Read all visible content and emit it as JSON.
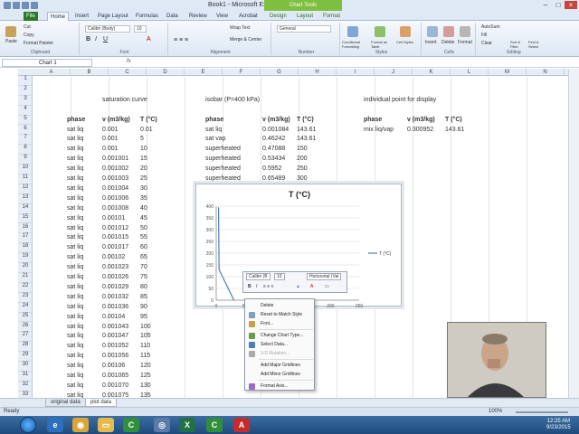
{
  "window": {
    "title": "Book1 - Microsoft Excel",
    "context_tab_group": "Chart Tools"
  },
  "tabs": [
    "File",
    "Home",
    "Insert",
    "Page Layout",
    "Formulas",
    "Data",
    "Review",
    "View",
    "Acrobat",
    "Design",
    "Layout",
    "Format"
  ],
  "ribbon": {
    "clipboard": {
      "label": "Clipboard",
      "paste": "Paste",
      "cut": "Cut",
      "copy": "Copy",
      "format_painter": "Format Painter"
    },
    "font": {
      "label": "Font",
      "font_name": "Calibri (Body)",
      "font_size": "10"
    },
    "alignment": {
      "label": "Alignment",
      "wrap": "Wrap Text",
      "merge": "Merge & Center"
    },
    "number": {
      "label": "Number",
      "format": "General"
    },
    "styles": {
      "label": "Styles",
      "conditional": "Conditional Formatting",
      "format_table": "Format as Table",
      "cell_styles": "Cell Styles"
    },
    "cells": {
      "label": "Cells",
      "insert": "Insert",
      "delete": "Delete",
      "format": "Format"
    },
    "editing": {
      "label": "Editing",
      "autosum": "AutoSum",
      "fill": "Fill",
      "clear": "Clear",
      "sort": "Sort & Filter",
      "find": "Find & Select"
    }
  },
  "formula_bar": {
    "name_box": "Chart 1",
    "fx": "fx"
  },
  "columns": [
    "A",
    "B",
    "C",
    "D",
    "E",
    "F",
    "G",
    "H",
    "I",
    "J",
    "K",
    "L",
    "M",
    "N"
  ],
  "rows": [
    "1",
    "2",
    "3",
    "4",
    "5",
    "6",
    "7",
    "8",
    "9",
    "10",
    "11",
    "12",
    "13",
    "14",
    "15",
    "16",
    "17",
    "18",
    "19",
    "20",
    "21",
    "22",
    "23",
    "24",
    "25",
    "26",
    "27",
    "28",
    "29",
    "30",
    "31",
    "32",
    "33"
  ],
  "sat_curve": {
    "title": "saturation curve",
    "headers": [
      "phase",
      "v (m3/kg)",
      "T (°C)"
    ],
    "rows": [
      [
        "sat liq",
        "0.001",
        "0.01"
      ],
      [
        "sat liq",
        "0.001",
        "5"
      ],
      [
        "sat liq",
        "0.001",
        "10"
      ],
      [
        "sat liq",
        "0.001001",
        "15"
      ],
      [
        "sat liq",
        "0.001002",
        "20"
      ],
      [
        "sat liq",
        "0.001003",
        "25"
      ],
      [
        "sat liq",
        "0.001004",
        "30"
      ],
      [
        "sat liq",
        "0.001006",
        "35"
      ],
      [
        "sat liq",
        "0.001008",
        "40"
      ],
      [
        "sat liq",
        "0.00101",
        "45"
      ],
      [
        "sat liq",
        "0.001012",
        "50"
      ],
      [
        "sat liq",
        "0.001015",
        "55"
      ],
      [
        "sat liq",
        "0.001017",
        "60"
      ],
      [
        "sat liq",
        "0.00102",
        "65"
      ],
      [
        "sat liq",
        "0.001023",
        "70"
      ],
      [
        "sat liq",
        "0.001026",
        "75"
      ],
      [
        "sat liq",
        "0.001029",
        "80"
      ],
      [
        "sat liq",
        "0.001032",
        "85"
      ],
      [
        "sat liq",
        "0.001036",
        "90"
      ],
      [
        "sat liq",
        "0.00104",
        "95"
      ],
      [
        "sat liq",
        "0.001043",
        "100"
      ],
      [
        "sat liq",
        "0.001047",
        "105"
      ],
      [
        "sat liq",
        "0.001052",
        "110"
      ],
      [
        "sat liq",
        "0.001056",
        "115"
      ],
      [
        "sat liq",
        "0.00106",
        "120"
      ],
      [
        "sat liq",
        "0.001065",
        "125"
      ],
      [
        "sat liq",
        "0.001070",
        "130"
      ],
      [
        "sat liq",
        "0.001075",
        "135"
      ]
    ]
  },
  "isobar": {
    "title": "isobar (P=400 kPa)",
    "headers": [
      "phase",
      "v (m3/kg)",
      "T (°C)"
    ],
    "rows": [
      [
        "sat liq",
        "0.001084",
        "143.61"
      ],
      [
        "sat vap",
        "0.46242",
        "143.61"
      ],
      [
        "superheated",
        "0.47088",
        "150"
      ],
      [
        "superheated",
        "0.53434",
        "200"
      ],
      [
        "superheated",
        "0.5952",
        "250"
      ],
      [
        "superheated",
        "0.65489",
        "300"
      ]
    ]
  },
  "point": {
    "title": "individual point for display",
    "headers": [
      "phase",
      "v (m3/kg)",
      "T (°C)"
    ],
    "row": [
      "mix liq/vap",
      "0.300952",
      "143.61"
    ]
  },
  "chart_data": {
    "type": "line",
    "title": "T (°C)",
    "series": [
      {
        "name": "T (°C)",
        "x": [
          0.001,
          0.001,
          0.001,
          0.001001,
          0.001002,
          0.001003,
          0.001004,
          0.001006,
          0.001008,
          0.00101,
          0.001012,
          0.001015,
          0.001017,
          0.00102,
          0.001023,
          0.001026,
          0.001029,
          0.001032,
          0.001036,
          0.00104,
          0.001043,
          0.001047,
          0.001052,
          0.001056,
          0.00106,
          0.001065,
          0.00107,
          0.001075
        ],
        "values": [
          0.01,
          5,
          10,
          15,
          20,
          25,
          30,
          35,
          40,
          45,
          50,
          55,
          60,
          65,
          70,
          75,
          80,
          85,
          90,
          95,
          100,
          105,
          110,
          115,
          120,
          125,
          130,
          135
        ]
      }
    ],
    "y_ticks": [
      "400",
      "350",
      "300",
      "250",
      "200",
      "150",
      "100",
      "50",
      "0"
    ],
    "x_ticks": [
      "0",
      "50",
      "100",
      "150",
      "200",
      "250"
    ],
    "ylim": [
      0,
      400
    ],
    "legend": "right",
    "color": "#4a7ebb"
  },
  "mini_toolbar": {
    "font": "Calibri (B",
    "size": "10",
    "chart_element": "Horizontal (Val"
  },
  "context_menu": [
    {
      "label": "Delete",
      "enabled": true,
      "icon": ""
    },
    {
      "label": "Reset to Match Style",
      "enabled": true,
      "icon": "reset-icon"
    },
    {
      "label": "Font...",
      "enabled": true,
      "icon": "font-icon"
    },
    {
      "label": "Change Chart Type...",
      "enabled": true,
      "icon": "chart-type-icon"
    },
    {
      "label": "Select Data...",
      "enabled": true,
      "icon": "select-data-icon"
    },
    {
      "label": "3-D Rotation...",
      "enabled": false,
      "icon": "rotation-icon"
    },
    {
      "label": "Add Major Gridlines",
      "enabled": true,
      "icon": ""
    },
    {
      "label": "Add Minor Gridlines",
      "enabled": true,
      "icon": ""
    },
    {
      "label": "Format Axis...",
      "enabled": true,
      "icon": "format-axis-icon"
    }
  ],
  "sheet_tabs": [
    "original data",
    "plot data"
  ],
  "status": {
    "ready": "Ready",
    "zoom": "100%"
  },
  "clock": {
    "time": "12:25 AM",
    "date": "9/23/2015"
  }
}
